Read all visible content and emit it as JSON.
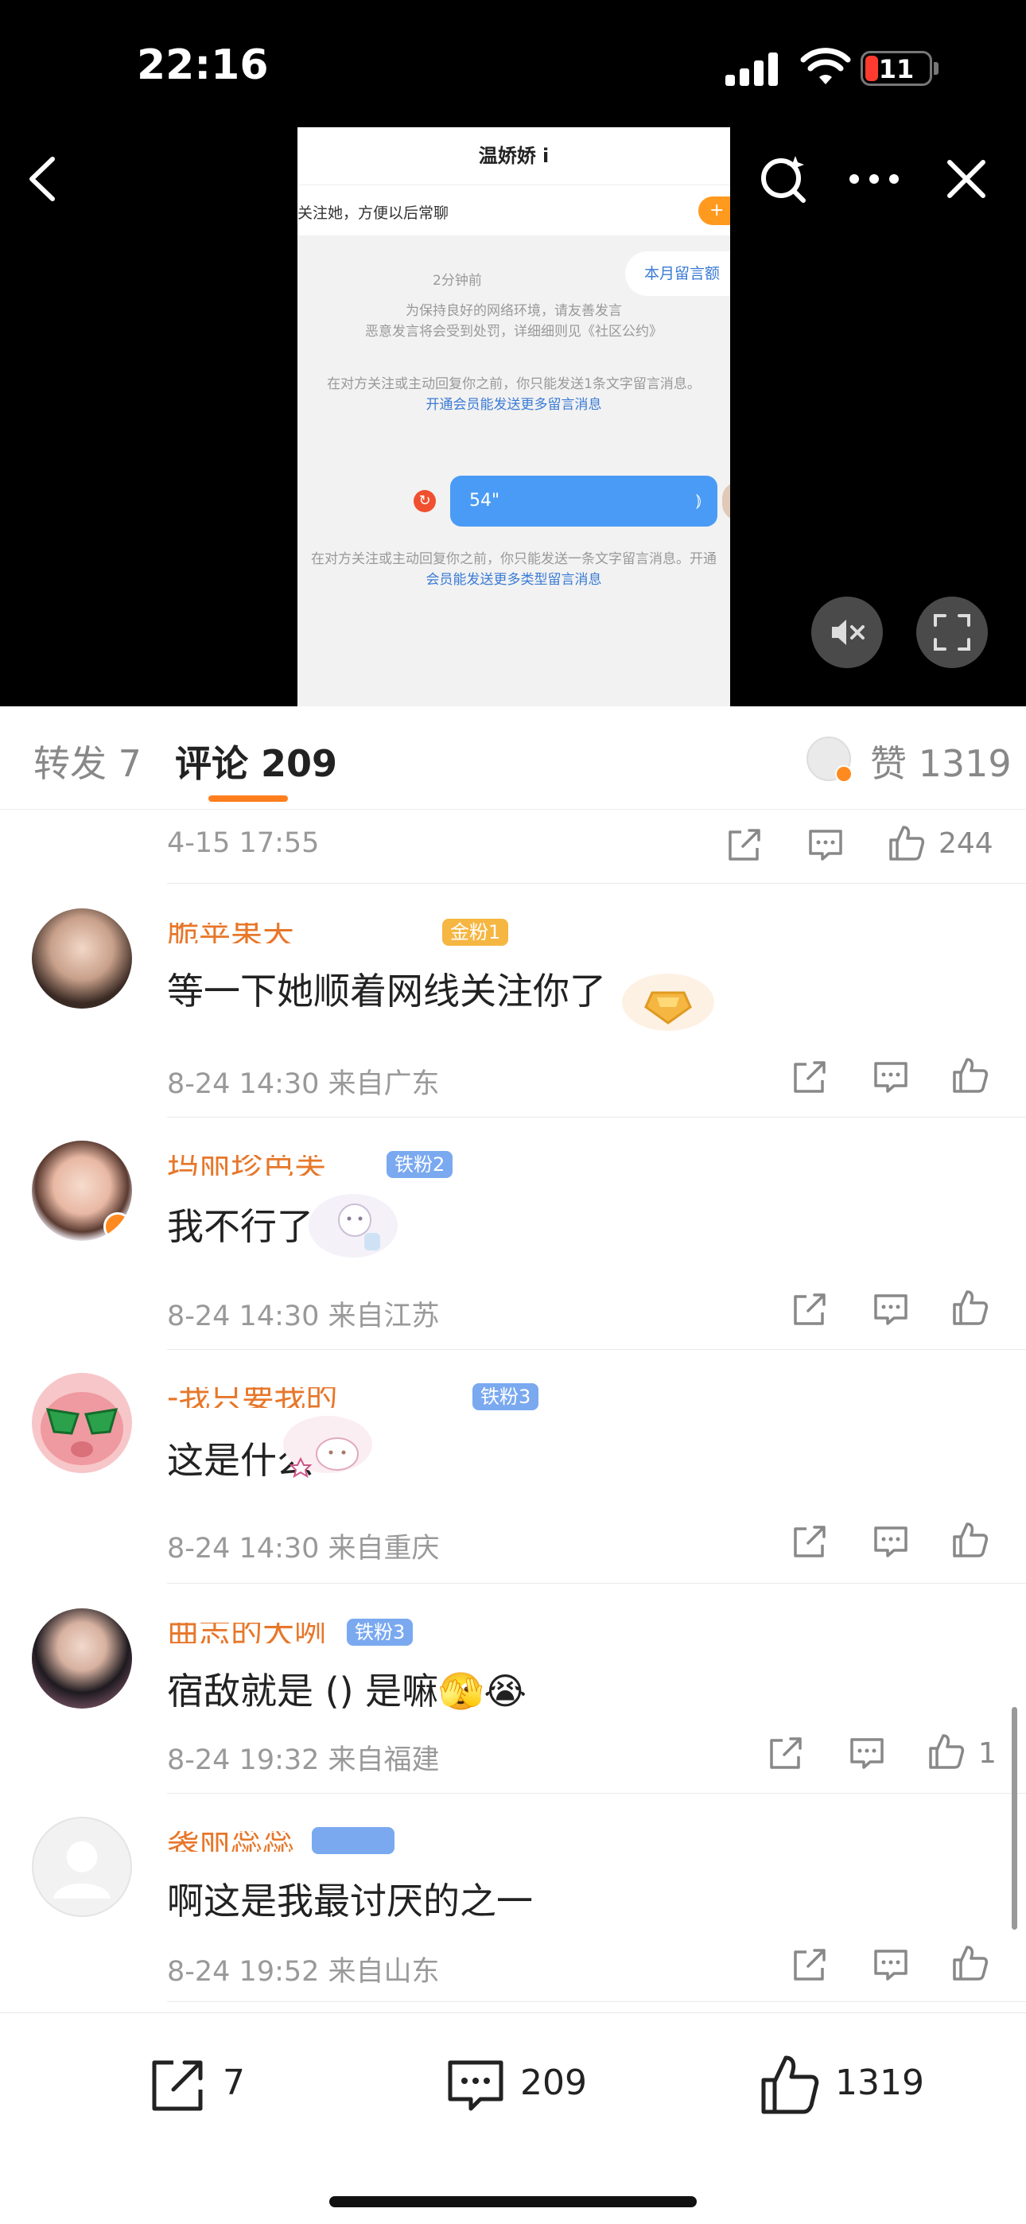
{
  "status_bar": {
    "time": "22:16",
    "battery": "11"
  },
  "video": {
    "screenshot": {
      "header_title": "温娇娇 i",
      "follow_prompt": "关注她，方便以后常聊",
      "follow_button": "+",
      "time_ago": "2分钟前",
      "quota_pill": "本月留言额",
      "notice_line1": "为保持良好的网络环境，请友善发言",
      "notice_line2": "恶意发言将会受到处罚，详细细则见《社区公约》",
      "limit_line1": "在对方关注或主动回复你之前，你只能发送1条文字留言消息。",
      "limit_line2": "开通会员能发送更多留言消息",
      "voice_duration": "54\"",
      "limit2_line1": "在对方关注或主动回复你之前，你只能发送一条文字留言消息。开通",
      "limit2_line2": "会员能发送更多类型留言消息"
    }
  },
  "tabs": {
    "repost": "转发 7",
    "comments_label": "评论",
    "comments_count": "209",
    "likes": "赞 1319"
  },
  "first_row": {
    "meta": "4-15 17:55",
    "likes": "244"
  },
  "comments": [
    {
      "name": "脆苹果天",
      "badge": "金粉1",
      "text": "等一下她顺着网线关注你了",
      "meta": "8-24 14:30 来自广东",
      "likes": ""
    },
    {
      "name": "玛丽珍芭芙",
      "badge": "铁粉2",
      "text": "我不行了",
      "meta": "8-24 14:30 来自江苏",
      "likes": ""
    },
    {
      "name": "-我只要我的",
      "badge": "铁粉3",
      "text": "这是什么",
      "meta": "8-24 14:30 来自重庆",
      "likes": ""
    },
    {
      "name": "曲志的大咧",
      "badge": "铁粉3",
      "text": "宿敌就是 () 是嘛🫣😭",
      "meta": "8-24 19:32 来自福建",
      "likes": "1"
    },
    {
      "name": "袭丽蕊蕊",
      "badge": "",
      "text": "啊这是我最讨厌的之一",
      "meta": "8-24 19:52 来自山东",
      "likes": ""
    }
  ],
  "bottom_bar": {
    "reposts": "7",
    "comments": "209",
    "likes": "1319"
  },
  "colors": {
    "accent": "#ff7e1d",
    "badge_gold": "#f5b642",
    "badge_iron": "#7aa9f0",
    "meta": "#999999"
  }
}
